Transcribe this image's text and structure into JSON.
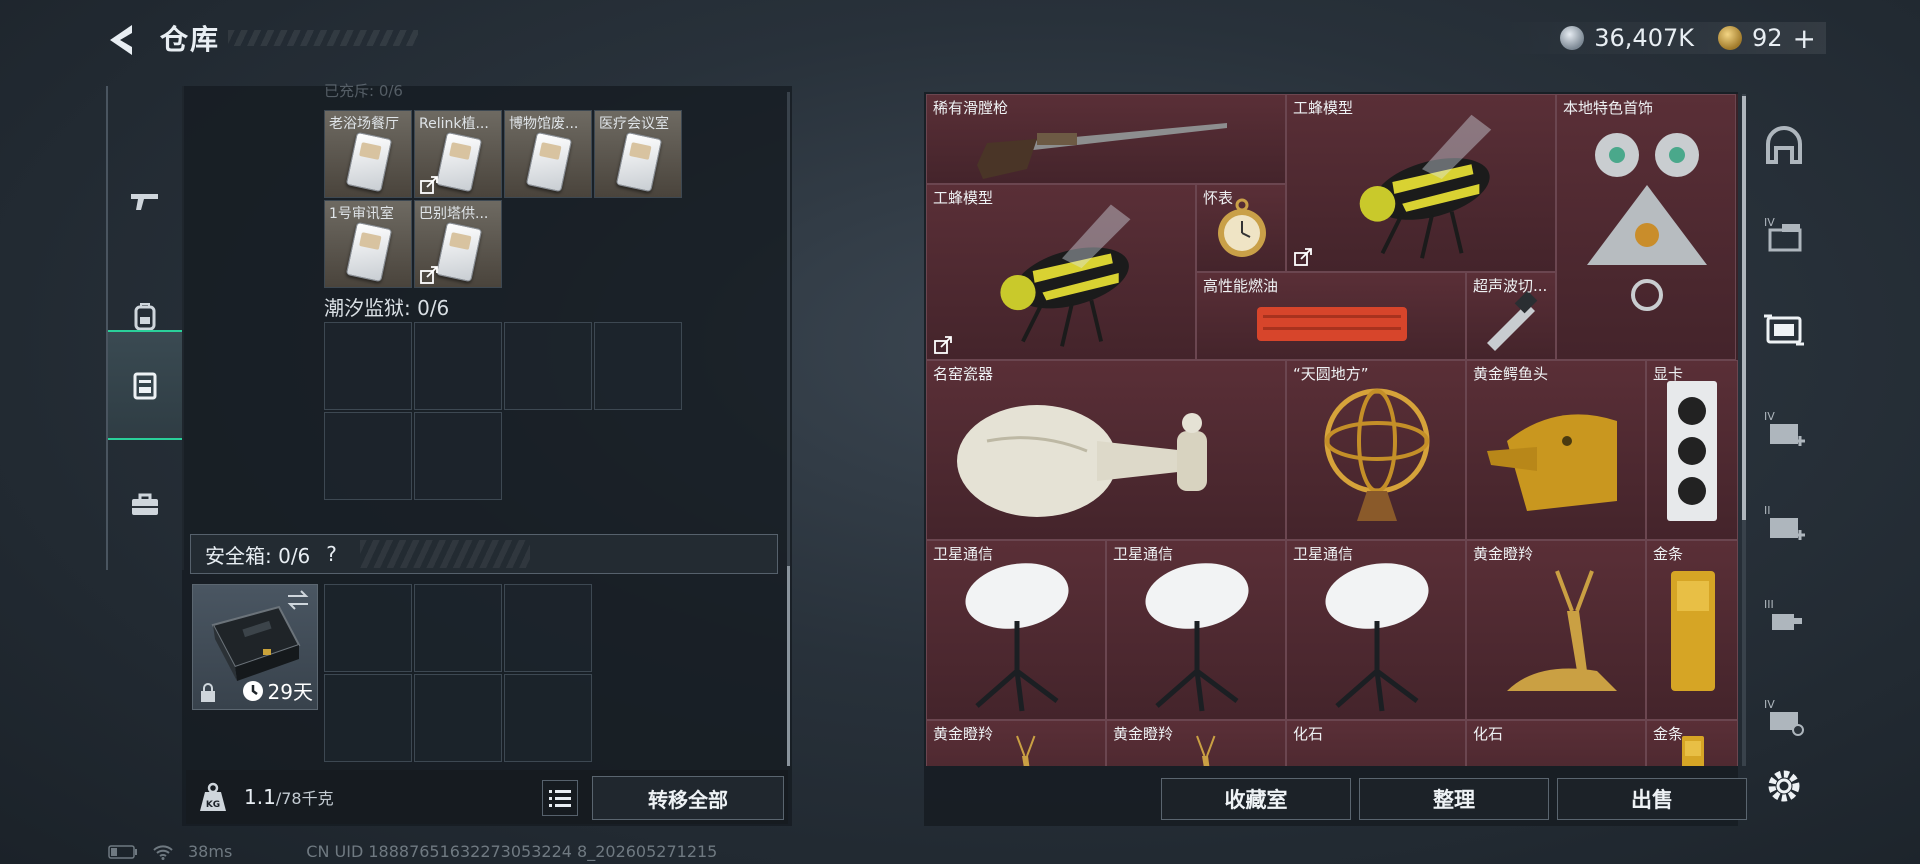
{
  "header": {
    "title": "仓库",
    "back_icon": "back-arrow-icon"
  },
  "currency": {
    "silver": "36,407K",
    "gold": "92",
    "add": "+"
  },
  "left_rail": {
    "items": [
      "gun-icon",
      "backpack-icon",
      "storage-icon",
      "toolbox-icon"
    ],
    "active": 2
  },
  "left_panel": {
    "cut_header": "已充斥: 0/6",
    "keycards": [
      {
        "label": "老浴场餐厅",
        "transfer": false
      },
      {
        "label": "Relink植...",
        "transfer": true
      },
      {
        "label": "博物馆废...",
        "transfer": false
      },
      {
        "label": "医疗会议室",
        "transfer": false
      },
      {
        "label": "1号审讯室",
        "transfer": false
      },
      {
        "label": "巴别塔供...",
        "transfer": true
      }
    ],
    "tide_label": "潮汐监狱: 0/6",
    "safebox_label": "安全箱: 0/6",
    "safebox_help": "?",
    "safebox_days": "29天",
    "weight_value": "1.1",
    "weight_total": "/78千克",
    "transfer_all": "转移全部"
  },
  "status_bar": {
    "ping": "38ms",
    "uid": "CN UID 18887651632273053224 8_202605271215"
  },
  "stash_items": [
    {
      "label": "稀有滑膛枪",
      "transfer": false,
      "icon": "musket-icon"
    },
    {
      "label": "工蜂模型",
      "transfer": true,
      "icon": "bee-model-icon"
    },
    {
      "label": "本地特色首饰",
      "transfer": false,
      "icon": "jewelry-icon"
    },
    {
      "label": "工蜂模型",
      "transfer": true,
      "icon": "bee-model-icon"
    },
    {
      "label": "怀表",
      "transfer": false,
      "icon": "pocket-watch-icon"
    },
    {
      "label": "高性能燃油",
      "transfer": false,
      "icon": "fuel-can-icon"
    },
    {
      "label": "超声波切...",
      "transfer": false,
      "icon": "ultrasonic-cutter-icon"
    },
    {
      "label": "名窑瓷器",
      "transfer": false,
      "icon": "porcelain-vase-icon"
    },
    {
      "label": "“天圆地方”",
      "transfer": false,
      "icon": "armillary-sphere-icon"
    },
    {
      "label": "黄金鳄鱼头",
      "transfer": false,
      "icon": "gold-crocodile-head-icon"
    },
    {
      "label": "显卡",
      "transfer": false,
      "icon": "graphics-card-icon"
    },
    {
      "label": "卫星通信",
      "transfer": false,
      "icon": "satellite-dish-icon"
    },
    {
      "label": "卫星通信",
      "transfer": false,
      "icon": "satellite-dish-icon"
    },
    {
      "label": "卫星通信",
      "transfer": false,
      "icon": "satellite-dish-icon"
    },
    {
      "label": "黄金瞪羚",
      "transfer": false,
      "icon": "gold-gazelle-icon"
    },
    {
      "label": "金条",
      "transfer": false,
      "icon": "gold-bar-icon"
    },
    {
      "label": "黄金瞪羚",
      "transfer": false,
      "icon": "gold-gazelle-icon"
    },
    {
      "label": "黄金瞪羚",
      "transfer": false,
      "icon": "gold-gazelle-icon"
    },
    {
      "label": "化石",
      "transfer": false,
      "icon": "fossil-icon"
    },
    {
      "label": "化石",
      "transfer": false,
      "icon": "fossil-icon"
    },
    {
      "label": "金条",
      "transfer": false,
      "icon": "gold-bar-icon"
    }
  ],
  "bottom_buttons": {
    "collection": "收藏室",
    "organize": "整理",
    "sell": "出售"
  },
  "right_rail": {
    "items": [
      "dome-icon",
      "case-iv-icon",
      "grid-container-icon",
      "case-iv-plus-icon",
      "case-ii-plus-icon",
      "case-iii-icon",
      "case-iv-settings-icon",
      "settings-gear-icon"
    ],
    "active": 2
  },
  "colors": {
    "accent": "#2ad09a",
    "stash_bg": "#44242b",
    "text": "#e8eef3"
  }
}
